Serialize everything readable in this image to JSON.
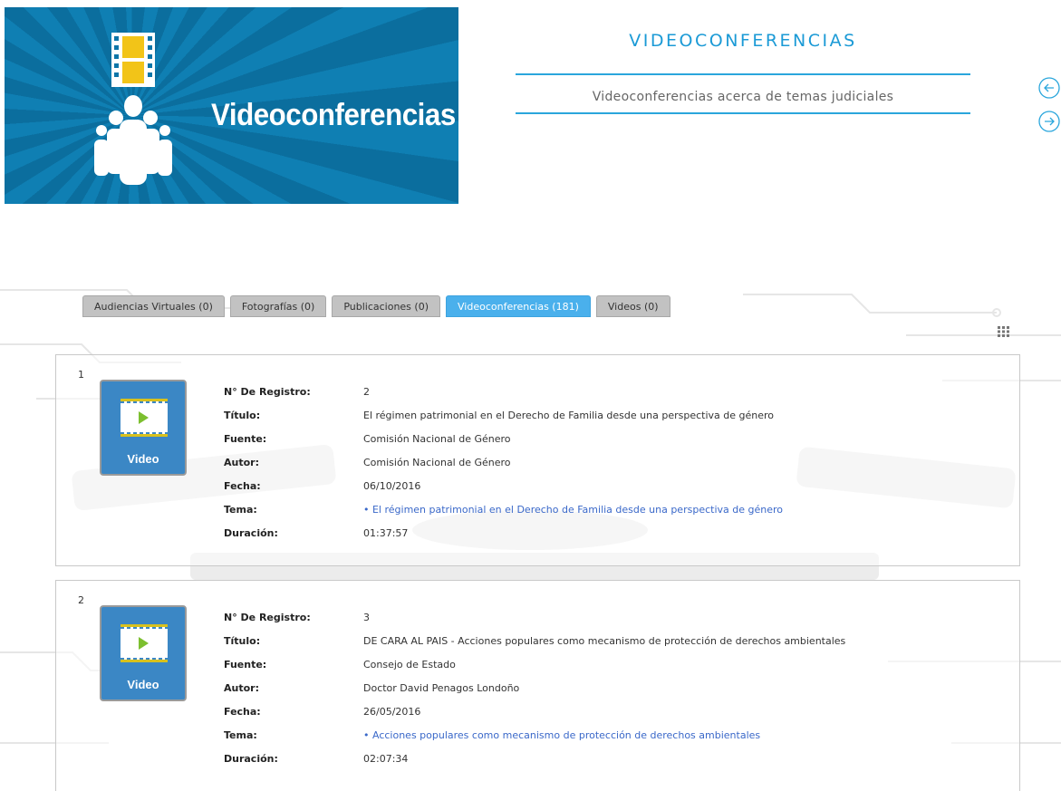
{
  "banner": {
    "title": "Videoconferencias",
    "film_icon": "film-strip-icon",
    "people_icon": "people-group-icon"
  },
  "header": {
    "title": "VIDEOCONFERENCIAS",
    "subtitle": "Videoconferencias acerca de temas judiciales",
    "prev_icon": "arrow-left-circle-icon",
    "next_icon": "arrow-right-circle-icon"
  },
  "tabs": [
    {
      "label": "Audiencias Virtuales (0)",
      "active": false
    },
    {
      "label": "Fotografías (0)",
      "active": false
    },
    {
      "label": "Publicaciones (0)",
      "active": false
    },
    {
      "label": "Videoconferencias (181)",
      "active": true
    },
    {
      "label": "Videos (0)",
      "active": false
    }
  ],
  "view_toggle_icon": "grid-view-icon",
  "field_labels": {
    "registro": "N° De Registro:",
    "titulo": "Título:",
    "fuente": "Fuente:",
    "autor": "Autor:",
    "fecha": "Fecha:",
    "tema": "Tema:",
    "duracion": "Duración:"
  },
  "records": [
    {
      "index": "1",
      "thumb_label": "Video",
      "registro": "2",
      "titulo": "El régimen patrimonial en el Derecho de Familia desde una perspectiva de género",
      "fuente": "Comisión Nacional de Género",
      "autor": "Comisión Nacional de Género",
      "fecha": "06/10/2016",
      "tema": "• El régimen patrimonial en el Derecho de Familia desde una perspectiva de género",
      "duracion": "01:37:57"
    },
    {
      "index": "2",
      "thumb_label": "Video",
      "registro": "3",
      "titulo": "DE CARA AL PAIS - Acciones populares como mecanismo de protección de derechos ambientales",
      "fuente": "Consejo de Estado",
      "autor": "Doctor David Penagos Londoño",
      "fecha": "26/05/2016",
      "tema": "• Acciones populares como mecanismo de protección de derechos ambientales",
      "duracion": "02:07:34"
    }
  ],
  "colors": {
    "accent": "#1b9ad6",
    "active_tab": "#4ab0ec",
    "tab": "#c2c2c2",
    "banner": "#0f7fb3",
    "link": "#3a68c9"
  }
}
